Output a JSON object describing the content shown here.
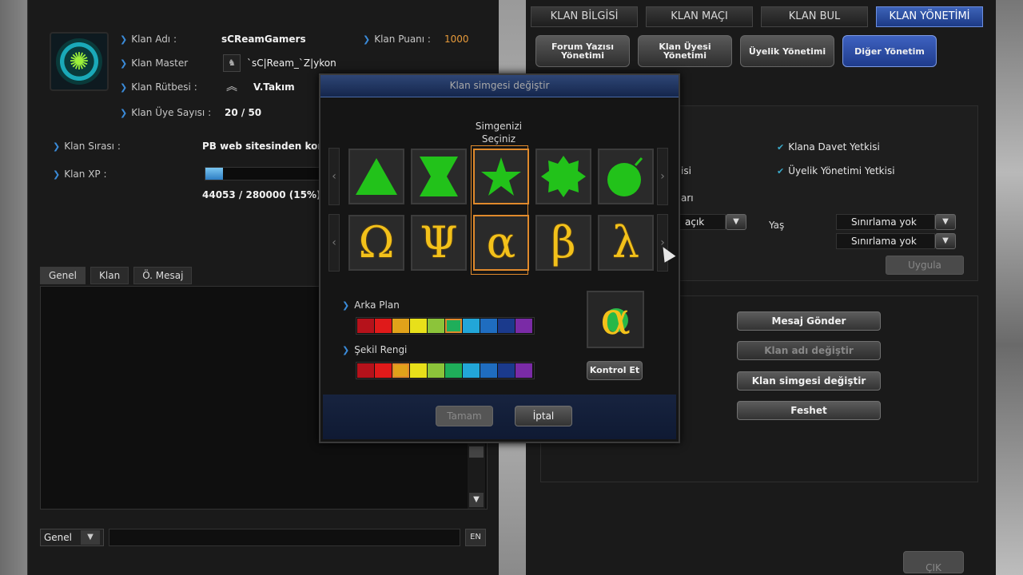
{
  "clan": {
    "name_label": "Klan Adı :",
    "name_value": "sCReamGamers",
    "points_label": "Klan Puanı :",
    "points_value": "1000",
    "master_label": "Klan Master",
    "master_value": "`sC|Ream_`Z|ykon",
    "rank_label": "Klan Rütbesi :",
    "rank_value": "V.Takım",
    "members_label": "Klan Üye Sayısı :",
    "members_value": "20 / 50",
    "order_label": "Klan Sırası :",
    "order_value": "PB web sitesinden kontr",
    "xp_label": "Klan XP :",
    "xp_value": "44053 / 280000 (15%)",
    "xp_fraction": 0.15
  },
  "chat": {
    "tabs": [
      "Genel",
      "Klan",
      "Ö. Mesaj"
    ],
    "channel": "Genel",
    "lang": "EN"
  },
  "top_tabs": [
    "KLAN BİLGİSİ",
    "KLAN MAÇI",
    "KLAN BUL",
    "KLAN YÖNETİMİ"
  ],
  "sub_tabs": [
    "Forum Yazısı Yönetimi",
    "Klan Üyesi Yönetimi",
    "Üyelik Yönetimi",
    "Diğer Yönetim"
  ],
  "permissions": {
    "invite": "Klana Davet Yetkisi",
    "membership": "Üyelik Yönetimi Yetkisi",
    "partial_1": "isi",
    "partial_2": "arı",
    "open_value": "açık",
    "age_label": "Yaş",
    "limit_1": "Sınırlama yok",
    "limit_2": "Sınırlama yok",
    "apply": "Uygula"
  },
  "actions": {
    "send_message": "Mesaj Gönder",
    "rename_clan": "Klan adı değiştir",
    "change_emblem": "Klan simgesi değiştir",
    "disband": "Feshet",
    "exit": "ÇIK"
  },
  "modal": {
    "title": "Klan simgesi değiştir",
    "choose_label": "Simgenizi Seçiniz",
    "shapes": [
      "triangle",
      "hourglass",
      "star",
      "burst",
      "bomb"
    ],
    "greek": [
      "Ω",
      "Ψ",
      "α",
      "β",
      "λ"
    ],
    "selected_index": 2,
    "background_label": "Arka Plan",
    "shape_color_label": "Şekil Rengi",
    "palette": [
      "#b5121b",
      "#e01a1a",
      "#e0a21a",
      "#e8e01a",
      "#8cc43a",
      "#1fae5a",
      "#22a6d8",
      "#1f6dc0",
      "#1b3a8c",
      "#7a2ba6"
    ],
    "background_selected": 5,
    "shape_color_selected": 2,
    "check_button": "Kontrol Et",
    "ok_button": "Tamam",
    "cancel_button": "İptal",
    "nav_left": "‹",
    "nav_right": "›"
  }
}
